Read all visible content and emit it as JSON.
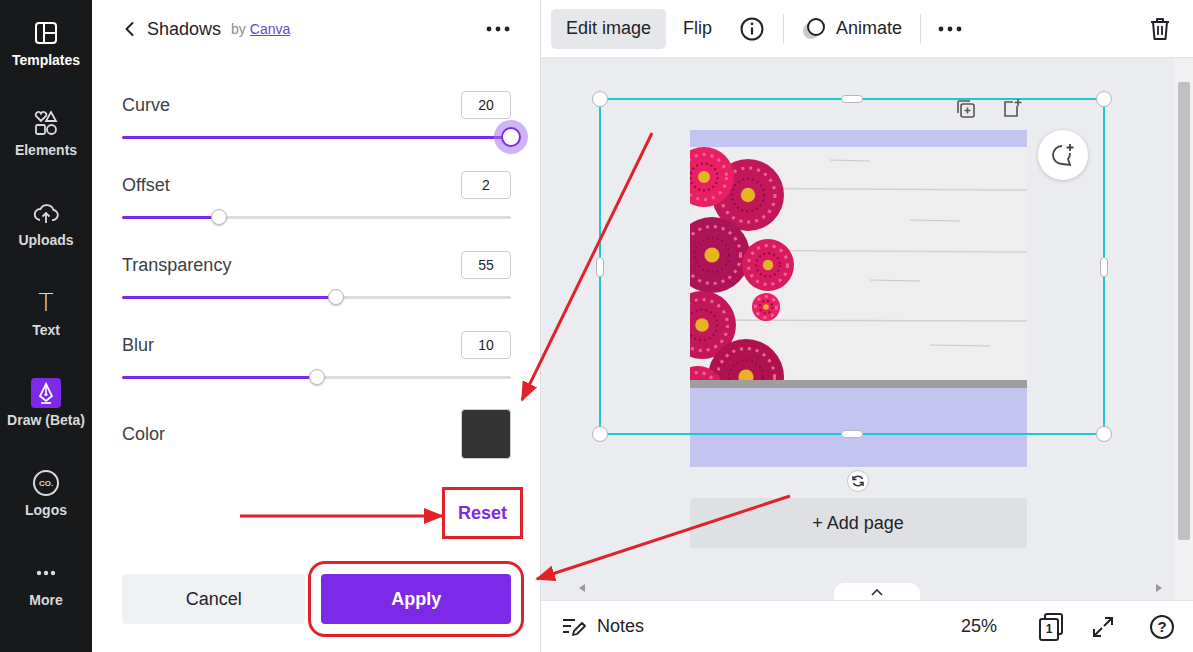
{
  "sidebar": {
    "items": [
      {
        "label": "Templates",
        "selected": true
      },
      {
        "label": "Elements",
        "selected": false
      },
      {
        "label": "Uploads",
        "selected": false
      },
      {
        "label": "Text",
        "selected": false,
        "glyph": "T"
      },
      {
        "label": "Draw (Beta)",
        "selected": false
      },
      {
        "label": "Logos",
        "selected": false,
        "glyph": "CO."
      },
      {
        "label": "More",
        "selected": false
      }
    ]
  },
  "panel": {
    "title": "Shadows",
    "by": "by",
    "author": "Canva",
    "controls": [
      {
        "kind": "slider",
        "label": "Curve",
        "value": "20",
        "level": 1,
        "focused": true
      },
      {
        "kind": "slider",
        "label": "Offset",
        "value": "2",
        "level": 0.25,
        "focused": false
      },
      {
        "kind": "slider",
        "label": "Transparency",
        "value": "55",
        "level": 0.55,
        "focused": false
      },
      {
        "kind": "slider",
        "label": "Blur",
        "value": "10",
        "level": 0.5,
        "focused": false
      },
      {
        "kind": "color",
        "label": "Color",
        "value": "#333333"
      }
    ],
    "reset": {
      "label": "Reset",
      "highlighted": true
    },
    "buttons": [
      {
        "label": "Cancel",
        "primary": false,
        "highlighted": false
      },
      {
        "label": "Apply",
        "primary": true,
        "highlighted": true
      }
    ]
  },
  "toolbar": {
    "buttons": [
      {
        "label": "Edit image",
        "selected": true
      },
      {
        "label": "Flip",
        "selected": false
      }
    ],
    "animate": "Animate"
  },
  "canvas": {
    "element_selected": true,
    "add_page": "+ Add page"
  },
  "footer": {
    "notes": "Notes",
    "zoom": "25%",
    "page_count": "1",
    "help": "?"
  }
}
